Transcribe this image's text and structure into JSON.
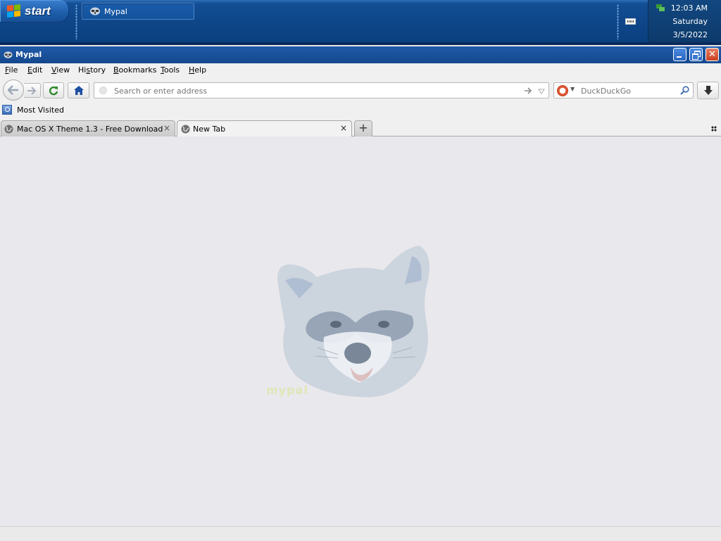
{
  "taskbar": {
    "start_label": "start",
    "task_buttons": [
      {
        "label": "Mypal",
        "icon": "mypal-raccoon-icon"
      }
    ],
    "tray": {
      "time": "12:03 AM",
      "day": "Saturday",
      "date": "3/5/2022"
    },
    "colors": {
      "taskbar": "#0e4689",
      "start": "#1c5ca8"
    }
  },
  "window": {
    "title": "Mypal",
    "controls": [
      "minimize",
      "restore",
      "close"
    ]
  },
  "menubar": {
    "items": [
      {
        "label": "File",
        "accel": "F"
      },
      {
        "label": "Edit",
        "accel": "E"
      },
      {
        "label": "View",
        "accel": "V"
      },
      {
        "label": "History",
        "accel": "s"
      },
      {
        "label": "Bookmarks",
        "accel": "B"
      },
      {
        "label": "Tools",
        "accel": "T"
      },
      {
        "label": "Help",
        "accel": "H"
      }
    ]
  },
  "navbar": {
    "url_placeholder": "Search or enter address",
    "url_value": "",
    "search_engine": "DuckDuckGo",
    "search_placeholder": "DuckDuckGo"
  },
  "bookmarks": {
    "items": [
      {
        "label": "Most Visited"
      }
    ]
  },
  "tabs": {
    "items": [
      {
        "label": "Mac OS X Theme 1.3 - Free Download",
        "active": false
      },
      {
        "label": "New Tab",
        "active": true
      }
    ]
  },
  "content": {
    "logo_text": "mypal",
    "background": "#e9e8ec"
  }
}
